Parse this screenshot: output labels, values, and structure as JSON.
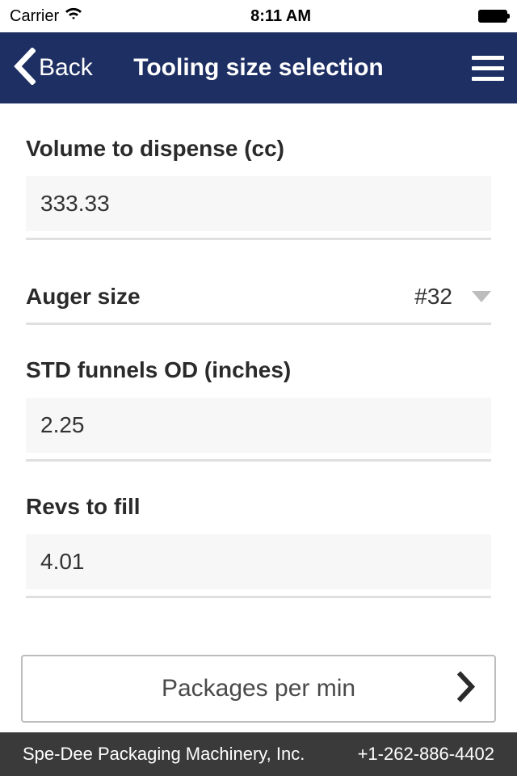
{
  "status": {
    "carrier": "Carrier",
    "time": "8:11 AM"
  },
  "nav": {
    "back": "Back",
    "title": "Tooling size selection"
  },
  "fields": {
    "volume_label": "Volume to dispense (cc)",
    "volume_value": "333.33",
    "auger_label": "Auger size",
    "auger_value": "#32",
    "funnel_label": "STD funnels OD (inches)",
    "funnel_value": "2.25",
    "revs_label": "Revs to fill",
    "revs_value": "4.01"
  },
  "nav_row": {
    "label": "Packages per min"
  },
  "footer": {
    "company": "Spe-Dee Packaging Machinery, Inc.",
    "phone": "+1-262-886-4402"
  }
}
